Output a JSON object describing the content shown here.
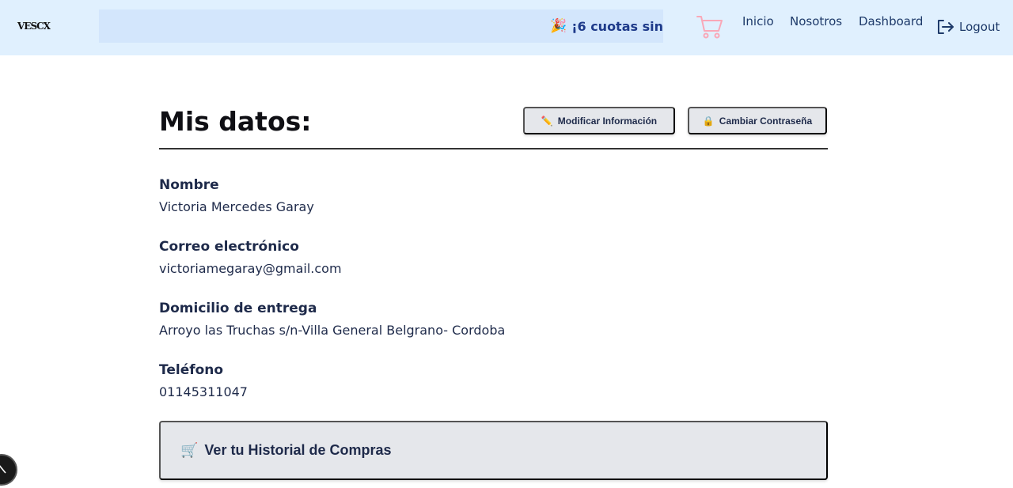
{
  "header": {
    "logo_text": "VESCX",
    "promo": {
      "icon": "🎉",
      "text": "¡6 cuotas sin"
    },
    "cart_icon": "cart-icon",
    "nav": [
      "Inicio",
      "Nosotros",
      "Dashboard"
    ],
    "logout_label": "Logout"
  },
  "profile": {
    "title": "Mis datos:",
    "edit_button": {
      "icon": "✏️",
      "label": "Modificar Información"
    },
    "password_button": {
      "icon": "🔒",
      "label": "Cambiar Contraseña"
    },
    "fields": [
      {
        "label": "Nombre",
        "value": "Victoria Mercedes Garay"
      },
      {
        "label": "Correo electrónico",
        "value": "victoriamegaray@gmail.com"
      },
      {
        "label": "Domicilio de entrega",
        "value": "Arroyo las Truchas s/n-Villa General Belgrano- Cordoba"
      },
      {
        "label": "Teléfono",
        "value": "01145311047"
      }
    ],
    "history_button": {
      "icon": "🛒",
      "label": "Ver tu Historial de Compras"
    }
  },
  "colors": {
    "header_bg": "#e0f0fe",
    "promo_bg": "#d3e6fc",
    "promo_text": "#1e3a8a",
    "cart": "#f9a8b8",
    "button_bg": "#e5e7eb",
    "text": "#1e2a4a"
  }
}
